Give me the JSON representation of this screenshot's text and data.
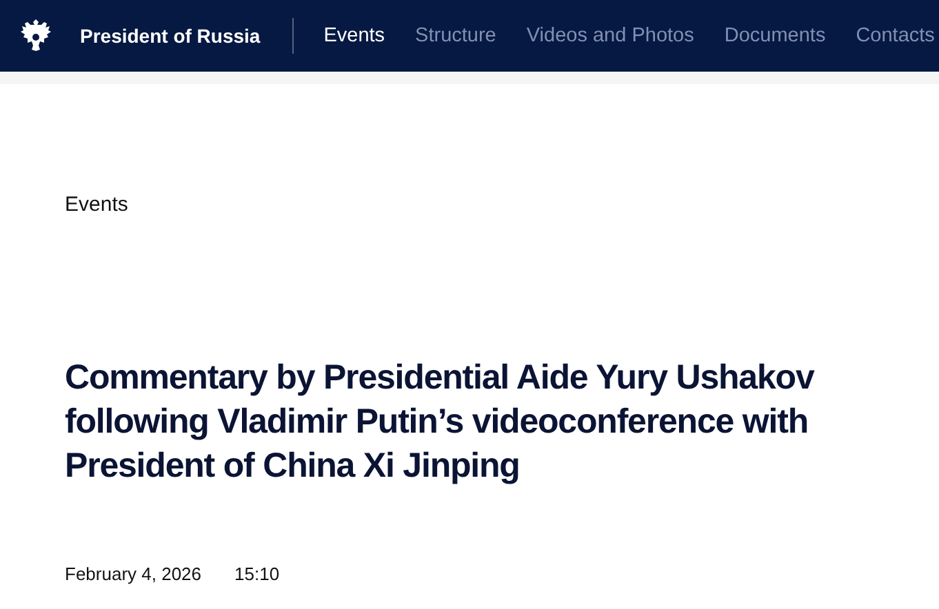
{
  "header": {
    "site_title": "President of Russia",
    "nav": [
      {
        "label": "Events",
        "selected": true
      },
      {
        "label": "Structure",
        "selected": false
      },
      {
        "label": "Videos and Photos",
        "selected": false
      },
      {
        "label": "Documents",
        "selected": false
      },
      {
        "label": "Contacts",
        "selected": false
      }
    ]
  },
  "section": "Events",
  "article": {
    "title": "Commentary by Presidential Aide Yury Ushakov following Vladimir Putin’s videoconference with President of China Xi Jinping",
    "date": "February 4, 2026",
    "time": "15:10"
  }
}
